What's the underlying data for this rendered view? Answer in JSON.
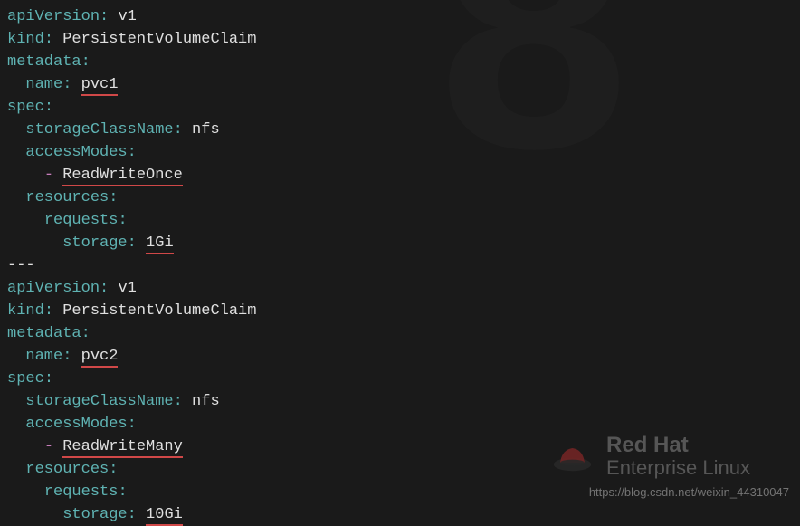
{
  "pvc1": {
    "apiVersion_key": "apiVersion",
    "apiVersion_val": "v1",
    "kind_key": "kind",
    "kind_val": "PersistentVolumeClaim",
    "metadata_key": "metadata",
    "name_key": "name",
    "name_val": "pvc1",
    "spec_key": "spec",
    "storageClassName_key": "storageClassName",
    "storageClassName_val": "nfs",
    "accessModes_key": "accessModes",
    "accessMode_val": "ReadWriteOnce",
    "resources_key": "resources",
    "requests_key": "requests",
    "storage_key": "storage",
    "storage_val": "1Gi"
  },
  "separator": "---",
  "pvc2": {
    "apiVersion_key": "apiVersion",
    "apiVersion_val": "v1",
    "kind_key": "kind",
    "kind_val": "PersistentVolumeClaim",
    "metadata_key": "metadata",
    "name_key": "name",
    "name_val": "pvc2",
    "spec_key": "spec",
    "storageClassName_key": "storageClassName",
    "storageClassName_val": "nfs",
    "accessModes_key": "accessModes",
    "accessMode_val": "ReadWriteMany",
    "resources_key": "resources",
    "requests_key": "requests",
    "storage_key": "storage",
    "storage_val": "10Gi"
  },
  "watermark": {
    "redhat": "Red Hat",
    "enterprise": "Enterprise Linux",
    "url": "https://blog.csdn.net/weixin_44310047"
  }
}
